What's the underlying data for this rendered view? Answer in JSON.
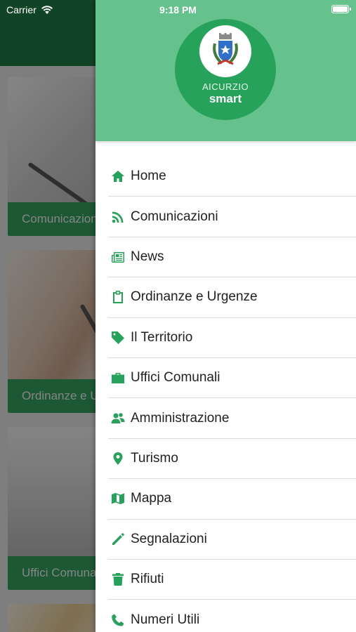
{
  "status_bar": {
    "carrier": "Carrier",
    "time": "9:18 PM"
  },
  "background": {
    "cards": [
      {
        "label": "Comunicazioni"
      },
      {
        "label": "Ordinanze e Urgenze"
      },
      {
        "label": "Uffici Comunali"
      },
      {
        "label": ""
      }
    ]
  },
  "drawer": {
    "logo": {
      "line1": "AICURZIO",
      "line2": "smart"
    },
    "menu": [
      {
        "label": "Home",
        "icon": "home-icon"
      },
      {
        "label": "Comunicazioni",
        "icon": "rss-icon"
      },
      {
        "label": "News",
        "icon": "newspaper-icon"
      },
      {
        "label": "Ordinanze e Urgenze",
        "icon": "clipboard-icon"
      },
      {
        "label": "Il Territorio",
        "icon": "tag-icon"
      },
      {
        "label": "Uffici Comunali",
        "icon": "briefcase-icon"
      },
      {
        "label": "Amministrazione",
        "icon": "users-icon"
      },
      {
        "label": "Turismo",
        "icon": "map-marker-icon"
      },
      {
        "label": "Mappa",
        "icon": "map-icon"
      },
      {
        "label": "Segnalazioni",
        "icon": "pencil-icon"
      },
      {
        "label": "Rifiuti",
        "icon": "trash-icon"
      },
      {
        "label": "Numeri Utili",
        "icon": "phone-icon"
      }
    ]
  },
  "colors": {
    "accent": "#27a25a",
    "header": "#66c28d",
    "app_bar": "#1f7a45"
  }
}
